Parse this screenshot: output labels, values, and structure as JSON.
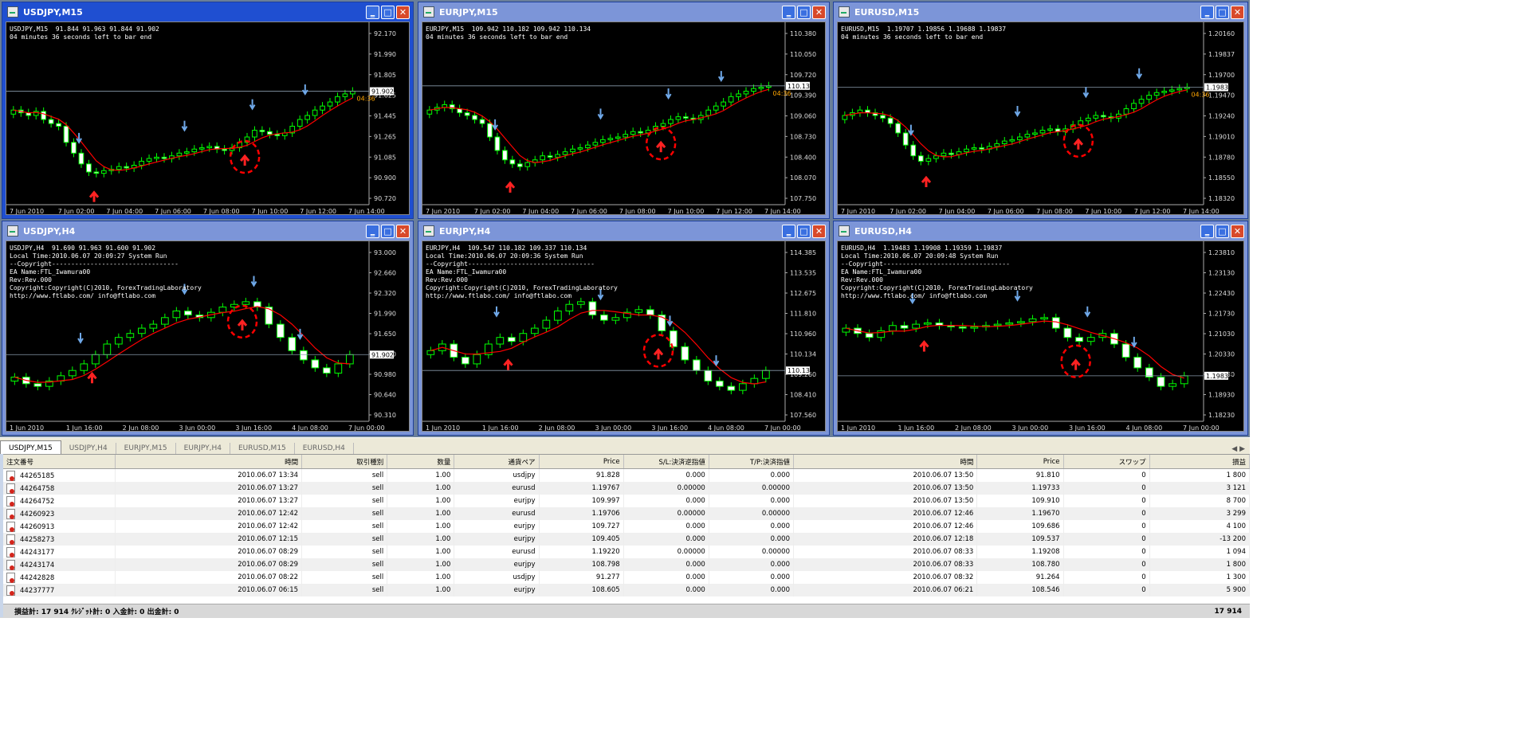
{
  "windows": [
    {
      "title": "USDJPY,M15",
      "state": "active",
      "info": "USDJPY,M15  91.844 91.963 91.844 91.902\n04 minutes 36 seconds left to bar end",
      "yticks": [
        "92.170",
        "91.990",
        "91.805",
        "91.625",
        "91.445",
        "91.265",
        "91.085",
        "90.900",
        "90.720"
      ],
      "price_tag": "91.902",
      "timer": "04:36",
      "xticks": [
        "7 Jun 2010",
        "7 Jun 02:00",
        "7 Jun 04:00",
        "7 Jun 06:00",
        "7 Jun 08:00",
        "7 Jun 10:00",
        "7 Jun 12:00",
        "7 Jun 14:00"
      ],
      "closes": [
        0.62,
        0.6,
        0.58,
        0.61,
        0.55,
        0.52,
        0.5,
        0.38,
        0.3,
        0.22,
        0.16,
        0.15,
        0.17,
        0.18,
        0.2,
        0.19,
        0.21,
        0.24,
        0.26,
        0.27,
        0.26,
        0.28,
        0.3,
        0.31,
        0.33,
        0.34,
        0.35,
        0.33,
        0.32,
        0.34,
        0.38,
        0.42,
        0.47,
        0.46,
        0.44,
        0.43,
        0.45,
        0.5,
        0.55,
        0.58,
        0.62,
        0.65,
        0.68,
        0.72,
        0.74,
        0.76
      ]
    },
    {
      "title": "EURJPY,M15",
      "state": "inactive",
      "info": "EURJPY,M15  109.942 110.182 109.942 110.134\n04 minutes 36 seconds left to bar end",
      "yticks": [
        "110.380",
        "110.050",
        "109.720",
        "109.390",
        "109.060",
        "108.730",
        "108.400",
        "108.070",
        "107.750"
      ],
      "price_tag": "110.134",
      "timer": "04:36",
      "xticks": [
        "7 Jun 2010",
        "7 Jun 02:00",
        "7 Jun 04:00",
        "7 Jun 06:00",
        "7 Jun 08:00",
        "7 Jun 10:00",
        "7 Jun 12:00",
        "7 Jun 14:00"
      ],
      "closes": [
        0.62,
        0.64,
        0.66,
        0.63,
        0.6,
        0.58,
        0.55,
        0.52,
        0.42,
        0.32,
        0.25,
        0.22,
        0.2,
        0.23,
        0.25,
        0.28,
        0.27,
        0.29,
        0.31,
        0.33,
        0.34,
        0.36,
        0.38,
        0.4,
        0.41,
        0.42,
        0.44,
        0.46,
        0.45,
        0.47,
        0.5,
        0.52,
        0.55,
        0.57,
        0.56,
        0.55,
        0.58,
        0.62,
        0.65,
        0.68,
        0.72,
        0.74,
        0.76,
        0.78,
        0.79,
        0.8
      ]
    },
    {
      "title": "EURUSD,M15",
      "state": "inactive",
      "info": "EURUSD,M15  1.19707 1.19856 1.19688 1.19837\n04 minutes 36 seconds left to bar end",
      "yticks": [
        "1.20160",
        "1.19837",
        "1.19700",
        "1.19470",
        "1.19240",
        "1.19010",
        "1.18780",
        "1.18550",
        "1.18320"
      ],
      "price_tag": "1.19837",
      "timer": "04:36",
      "xticks": [
        "7 Jun 2010",
        "7 Jun 02:00",
        "7 Jun 04:00",
        "7 Jun 06:00",
        "7 Jun 08:00",
        "7 Jun 10:00",
        "7 Jun 12:00",
        "7 Jun 14:00"
      ],
      "closes": [
        0.58,
        0.6,
        0.62,
        0.6,
        0.58,
        0.56,
        0.52,
        0.45,
        0.36,
        0.28,
        0.24,
        0.26,
        0.28,
        0.3,
        0.29,
        0.31,
        0.33,
        0.34,
        0.33,
        0.35,
        0.37,
        0.39,
        0.4,
        0.42,
        0.44,
        0.45,
        0.47,
        0.48,
        0.46,
        0.48,
        0.51,
        0.54,
        0.56,
        0.58,
        0.57,
        0.56,
        0.59,
        0.63,
        0.67,
        0.7,
        0.73,
        0.75,
        0.76,
        0.77,
        0.78,
        0.79
      ]
    },
    {
      "title": "USDJPY,H4",
      "state": "inactive",
      "info": "USDJPY,H4  91.690 91.963 91.600 91.902\nLocal Time:2010.06.07 20:09:27 System Run\n--Copyright---------------------------------\nEA Name:FTL_Iwamura00\nRev:Rev.000\nCopyright:Copyright(C)2010, ForexTradingLaboratory\nhttp://www.ftlabo.com/ info@ftlabo.com",
      "yticks": [
        "93.000",
        "92.660",
        "92.320",
        "91.990",
        "91.650",
        "91.310",
        "90.980",
        "90.640",
        "90.310"
      ],
      "price_tag": "91.902",
      "timer": "",
      "xticks": [
        "1 Jun 2010",
        "1 Jun 16:00",
        "2 Jun 08:00",
        "3 Jun 00:00",
        "3 Jun 16:00",
        "4 Jun 08:00",
        "7 Jun 00:00"
      ],
      "closes": [
        0.25,
        0.2,
        0.18,
        0.22,
        0.26,
        0.3,
        0.35,
        0.42,
        0.5,
        0.55,
        0.58,
        0.62,
        0.65,
        0.7,
        0.75,
        0.72,
        0.7,
        0.74,
        0.78,
        0.8,
        0.82,
        0.78,
        0.65,
        0.55,
        0.45,
        0.38,
        0.32,
        0.28,
        0.35,
        0.42
      ]
    },
    {
      "title": "EURJPY,H4",
      "state": "inactive",
      "info": "EURJPY,H4  109.547 110.182 109.337 110.134\nLocal Time:2010.06.07 20:09:36 System Run\n--Copyright---------------------------------\nEA Name:FTL_Iwamura00\nRev:Rev.000\nCopyright:Copyright(C)2010, ForexTradingLaboratory\nhttp://www.ftlabo.com/ info@ftlabo.com",
      "yticks": [
        "114.385",
        "113.535",
        "112.675",
        "111.810",
        "110.960",
        "110.134",
        "109.260",
        "108.410",
        "107.560"
      ],
      "price_tag": "110.134",
      "timer": "",
      "xticks": [
        "1 Jun 2010",
        "1 Jun 16:00",
        "2 Jun 08:00",
        "3 Jun 00:00",
        "3 Jun 16:00",
        "4 Jun 08:00",
        "7 Jun 00:00"
      ],
      "closes": [
        0.45,
        0.5,
        0.4,
        0.35,
        0.42,
        0.5,
        0.55,
        0.52,
        0.58,
        0.62,
        0.68,
        0.75,
        0.8,
        0.82,
        0.72,
        0.68,
        0.7,
        0.74,
        0.76,
        0.72,
        0.6,
        0.48,
        0.38,
        0.3,
        0.22,
        0.18,
        0.15,
        0.2,
        0.24,
        0.3
      ]
    },
    {
      "title": "EURUSD,H4",
      "state": "inactive",
      "info": "EURUSD,H4  1.19483 1.19908 1.19359 1.19837\nLocal Time:2010.06.07 20:09:48 System Run\n--Copyright---------------------------------\nEA Name:FTL_Iwamura00\nRev:Rev.000\nCopyright:Copyright(C)2010, ForexTradingLaboratory\nhttp://www.ftlabo.com/ info@ftlabo.com",
      "yticks": [
        "1.23810",
        "1.23130",
        "1.22430",
        "1.21730",
        "1.21030",
        "1.20330",
        "1.19630",
        "1.18930",
        "1.18230"
      ],
      "price_tag": "1.19837",
      "timer": "",
      "xticks": [
        "1 Jun 2010",
        "1 Jun 16:00",
        "2 Jun 08:00",
        "3 Jun 00:00",
        "3 Jun 16:00",
        "4 Jun 08:00",
        "7 Jun 00:00"
      ],
      "closes": [
        0.62,
        0.58,
        0.55,
        0.6,
        0.64,
        0.62,
        0.65,
        0.66,
        0.64,
        0.63,
        0.62,
        0.63,
        0.64,
        0.65,
        0.66,
        0.67,
        0.69,
        0.7,
        0.62,
        0.55,
        0.52,
        0.55,
        0.58,
        0.5,
        0.4,
        0.32,
        0.25,
        0.18,
        0.2,
        0.26
      ]
    }
  ],
  "tabs": [
    "USDJPY,M15",
    "USDJPY,H4",
    "EURJPY,M15",
    "EURJPY,H4",
    "EURUSD,M15",
    "EURUSD,H4"
  ],
  "tab_nav": "◀ ▶",
  "columns": [
    "注文番号",
    "時間",
    "取引種別",
    "数量",
    "通貨ペア",
    "Price",
    "S/L:決済逆指値",
    "T/P:決済指値",
    "時間",
    "Price",
    "スワップ",
    "損益"
  ],
  "rows": [
    [
      "44265185",
      "2010.06.07 13:34",
      "sell",
      "1.00",
      "usdjpy",
      "91.828",
      "0.000",
      "0.000",
      "2010.06.07 13:50",
      "91.810",
      "0",
      "1 800"
    ],
    [
      "44264758",
      "2010.06.07 13:27",
      "sell",
      "1.00",
      "eurusd",
      "1.19767",
      "0.00000",
      "0.00000",
      "2010.06.07 13:50",
      "1.19733",
      "0",
      "3 121"
    ],
    [
      "44264752",
      "2010.06.07 13:27",
      "sell",
      "1.00",
      "eurjpy",
      "109.997",
      "0.000",
      "0.000",
      "2010.06.07 13:50",
      "109.910",
      "0",
      "8 700"
    ],
    [
      "44260923",
      "2010.06.07 12:42",
      "sell",
      "1.00",
      "eurusd",
      "1.19706",
      "0.00000",
      "0.00000",
      "2010.06.07 12:46",
      "1.19670",
      "0",
      "3 299"
    ],
    [
      "44260913",
      "2010.06.07 12:42",
      "sell",
      "1.00",
      "eurjpy",
      "109.727",
      "0.000",
      "0.000",
      "2010.06.07 12:46",
      "109.686",
      "0",
      "4 100"
    ],
    [
      "44258273",
      "2010.06.07 12:15",
      "sell",
      "1.00",
      "eurjpy",
      "109.405",
      "0.000",
      "0.000",
      "2010.06.07 12:18",
      "109.537",
      "0",
      "-13 200"
    ],
    [
      "44243177",
      "2010.06.07 08:29",
      "sell",
      "1.00",
      "eurusd",
      "1.19220",
      "0.00000",
      "0.00000",
      "2010.06.07 08:33",
      "1.19208",
      "0",
      "1 094"
    ],
    [
      "44243174",
      "2010.06.07 08:29",
      "sell",
      "1.00",
      "eurjpy",
      "108.798",
      "0.000",
      "0.000",
      "2010.06.07 08:33",
      "108.780",
      "0",
      "1 800"
    ],
    [
      "44242828",
      "2010.06.07 08:22",
      "sell",
      "1.00",
      "usdjpy",
      "91.277",
      "0.000",
      "0.000",
      "2010.06.07 08:32",
      "91.264",
      "0",
      "1 300"
    ],
    [
      "44237777",
      "2010.06.07 06:15",
      "sell",
      "1.00",
      "eurjpy",
      "108.605",
      "0.000",
      "0.000",
      "2010.06.07 06:21",
      "108.546",
      "0",
      "5 900"
    ]
  ],
  "status": {
    "summary": "損益計: 17 914  ｸﾚｼﾞｯﾄ計: 0  入金計: 0  出金計: 0",
    "total": "17 914"
  },
  "colors": {
    "bull": "#00ff00",
    "bear": "#ffffff",
    "ma": "#ff0000",
    "up_arrow": "#ff2222",
    "down_arrow": "#6fa8e8",
    "circle": "#ff0000"
  }
}
